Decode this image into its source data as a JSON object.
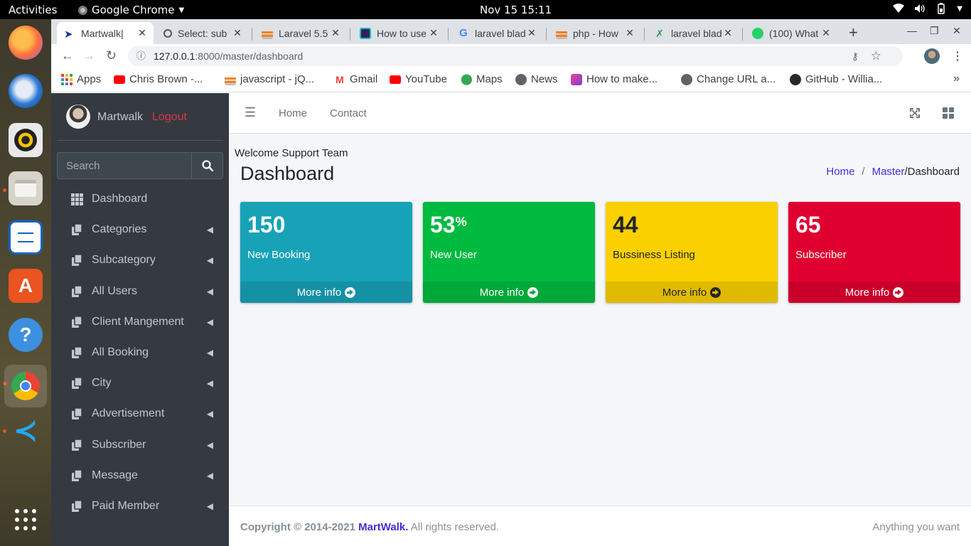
{
  "topbar": {
    "activities": "Activities",
    "app": "Google Chrome",
    "clock": "Nov 15  15:11"
  },
  "tabs": [
    {
      "title": "Martwalk|",
      "favicon_color": "#1a3b8c"
    },
    {
      "title": "Select: sub",
      "favicon_color": "#555555"
    },
    {
      "title": "Laravel 5.5",
      "favicon_color": "#f48024"
    },
    {
      "title": "How to use",
      "favicon_color": "#3a1c5c"
    },
    {
      "title": "laravel blad",
      "favicon_color": "#4285f4"
    },
    {
      "title": "php - How",
      "favicon_color": "#f48024"
    },
    {
      "title": "laravel blad",
      "favicon_color": "#2e9a5c"
    },
    {
      "title": "(100) What",
      "favicon_color": "#25d366"
    }
  ],
  "toolbar": {
    "url_host": "127.0.0.1",
    "url_path": ":8000/master/dashboard"
  },
  "bookmarks": [
    {
      "label": "Apps",
      "color": "#e94235"
    },
    {
      "label": "Chris Brown -...",
      "color": "#ff0000"
    },
    {
      "label": "javascript - jQ...",
      "color": "#f48024"
    },
    {
      "label": "Gmail",
      "color": "#ea4335"
    },
    {
      "label": "YouTube",
      "color": "#ff0000"
    },
    {
      "label": "Maps",
      "color": "#34a853"
    },
    {
      "label": "News",
      "color": "#5f6368"
    },
    {
      "label": "How to make...",
      "color": "#e8477e"
    },
    {
      "label": "Change URL a...",
      "color": "#5f6368"
    },
    {
      "label": "GitHub - Willia...",
      "color": "#24292e"
    }
  ],
  "sidebar": {
    "username": "Martwalk",
    "logout": "Logout",
    "search_placeholder": "Search",
    "items": [
      {
        "label": "Dashboard"
      },
      {
        "label": "Categories"
      },
      {
        "label": "Subcategory"
      },
      {
        "label": "All Users"
      },
      {
        "label": "Client Mangement"
      },
      {
        "label": "All Booking"
      },
      {
        "label": "City"
      },
      {
        "label": "Advertisement"
      },
      {
        "label": "Subscriber"
      },
      {
        "label": "Message"
      },
      {
        "label": "Paid Member"
      }
    ]
  },
  "header": {
    "home": "Home",
    "contact": "Contact"
  },
  "content": {
    "welcome": "Welcome Support Team",
    "title": "Dashboard",
    "breadcrumb": {
      "home": "Home",
      "master": "Master",
      "current": "/Dashboard"
    }
  },
  "boxes": [
    {
      "value": "150",
      "sup": "",
      "label": "New Booking",
      "more": "More info",
      "color": "#17a2b8"
    },
    {
      "value": "53",
      "sup": "%",
      "label": "New User",
      "more": "More info",
      "color": "#00ba40"
    },
    {
      "value": "44",
      "sup": "",
      "label": "Bussiness Listing",
      "more": "More info",
      "color": "#fad000"
    },
    {
      "value": "65",
      "sup": "",
      "label": "Subscriber",
      "more": "More info",
      "color": "#e0002f"
    }
  ],
  "footer": {
    "copy_prefix": "Copyright © 2014-2021 ",
    "brand": "MartWalk.",
    "copy_suffix": " All rights reserved.",
    "right": "Anything you want"
  }
}
